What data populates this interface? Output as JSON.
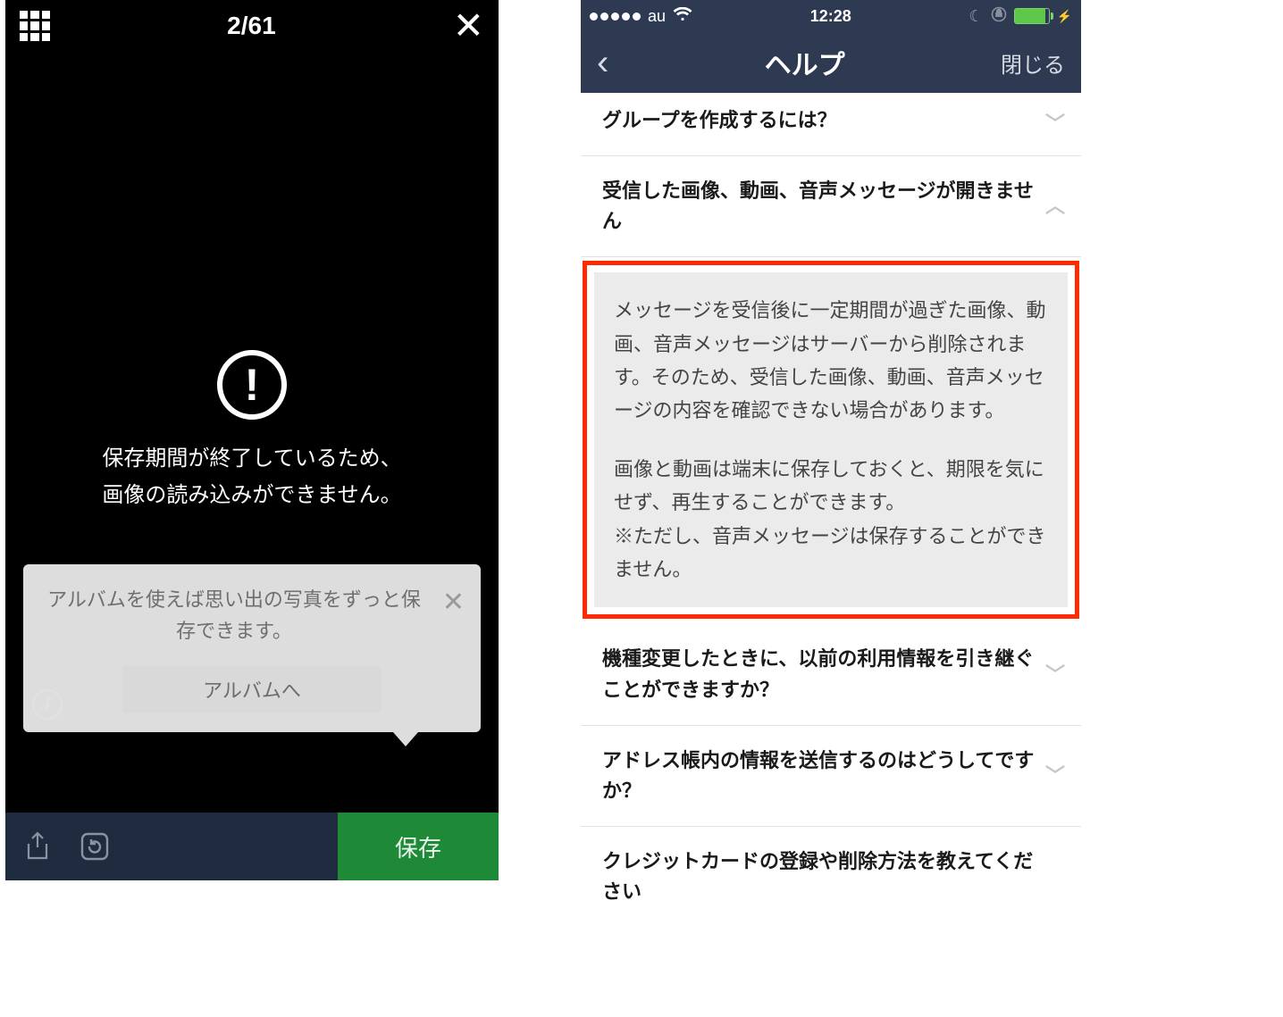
{
  "left": {
    "counter": "2/61",
    "error_line1": "保存期間が終了しているため、",
    "error_line2": "画像の読み込みができません。",
    "tip_text": "アルバムを使えば思い出の写真をずっと保存できます。",
    "tip_button": "アルバムへ",
    "save_button": "保存"
  },
  "right": {
    "status": {
      "carrier": "au",
      "time": "12:28"
    },
    "nav": {
      "title": "ヘルプ",
      "close": "閉じる"
    },
    "faq1": "グループを作成するには？",
    "faq2": "受信した画像、動画、音声メッセージが開きません",
    "answer_p1": "メッセージを受信後に一定期間が過ぎた画像、動画、音声メッセージはサーバーから削除されます。そのため、受信した画像、動画、音声メッセージの内容を確認できない場合があります。",
    "answer_p2": "画像と動画は端末に保存しておくと、期限を気にせず、再生することができます。\n※ただし、音声メッセージは保存することができません。",
    "faq3": "機種変更したときに、以前の利用情報を引き継ぐことができますか？",
    "faq4": "アドレス帳内の情報を送信するのはどうしてですか？",
    "faq5": "クレジットカードの登録や削除方法を教えてください"
  }
}
